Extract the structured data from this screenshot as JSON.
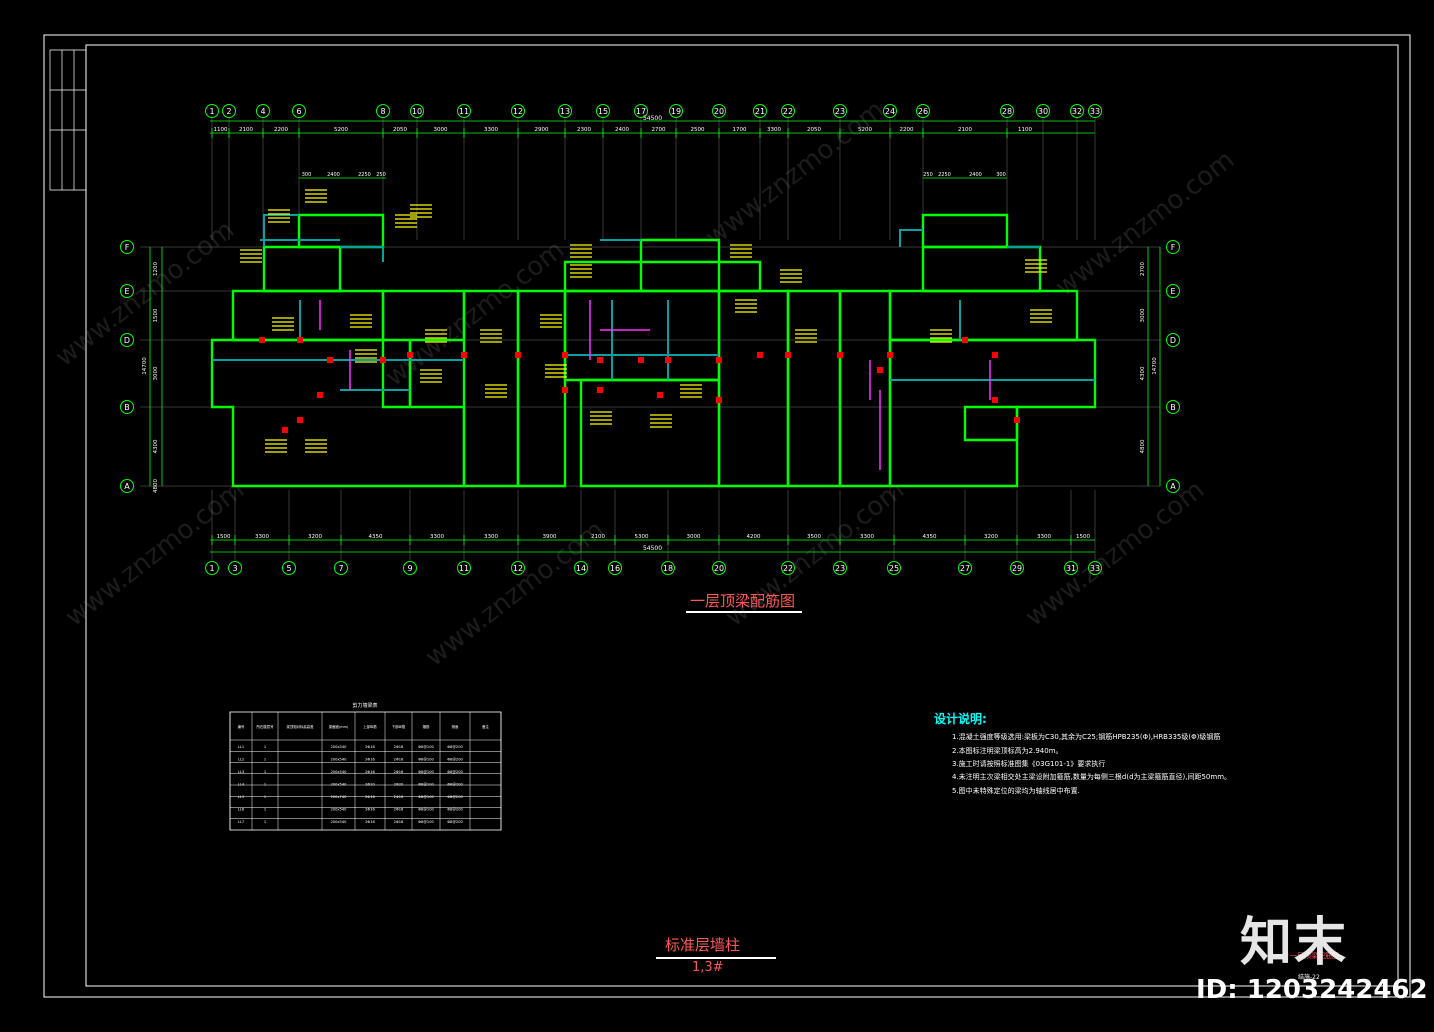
{
  "drawing": {
    "plan_title": "一层顶梁配筋图",
    "sub_title": "标准层墙柱",
    "sub_title_2": "1,3#",
    "total_dim": "54500",
    "top_axes": [
      "1",
      "2",
      "4",
      "6",
      "8",
      "10",
      "11",
      "12",
      "13",
      "15",
      "17",
      "19",
      "20",
      "21",
      "22",
      "23",
      "24",
      "26",
      "28",
      "30",
      "32",
      "33"
    ],
    "top_dims": [
      "1100",
      "2100",
      "2200",
      "5200",
      "2050",
      "3000",
      "3300",
      "2900",
      "2300",
      "2400",
      "2700",
      "2500",
      "1700",
      "3300",
      "2050",
      "5200",
      "2200",
      "2100",
      "1100"
    ],
    "bottom_axes": [
      "1",
      "3",
      "5",
      "7",
      "9",
      "11",
      "12",
      "14",
      "16",
      "18",
      "20",
      "22",
      "23",
      "25",
      "27",
      "29",
      "31",
      "33"
    ],
    "bottom_dims": [
      "1500",
      "3300",
      "3200",
      "4350",
      "3300",
      "3300",
      "3900",
      "2100",
      "5300",
      "3000",
      "4200",
      "3500",
      "3300",
      "4350",
      "3200",
      "3300",
      "1500"
    ],
    "row_axes": [
      "F",
      "E",
      "D",
      "B",
      "A"
    ],
    "left_dims": [
      "1200",
      "1500",
      "3000",
      "4300",
      "4800"
    ],
    "left_total": "14700",
    "right_dims": [
      "2700",
      "3000",
      "4300",
      "4800"
    ],
    "right_total": "14700",
    "upper_sub_dims_left": [
      "300",
      "2400",
      "2250",
      "250"
    ],
    "upper_sub_dims_right": [
      "250",
      "2250",
      "2400",
      "300"
    ]
  },
  "table": {
    "title": "剪力墙梁表",
    "headers": [
      "编号",
      "所在楼层号",
      "梁顶相对标高高差",
      "梁截面(mm)",
      "上部纵筋",
      "下部纵筋",
      "箍筋",
      "侧面",
      "备注"
    ],
    "rows": [
      [
        "LL1",
        "1",
        "",
        "200x540",
        "2Φ16",
        "2Φ16",
        "Φ8@100",
        "Φ8@200",
        ""
      ],
      [
        "LL2",
        "1",
        "",
        "200x540",
        "2Φ16",
        "2Φ16",
        "Φ8@100",
        "Φ8@200",
        ""
      ],
      [
        "LL3",
        "1",
        "",
        "200x540",
        "2Φ16",
        "2Φ16",
        "Φ8@100",
        "Φ8@200",
        ""
      ],
      [
        "LL4",
        "1",
        "",
        "200x540",
        "2Φ20",
        "2Φ20",
        "Φ8@100",
        "Φ8@200",
        ""
      ],
      [
        "LL5",
        "1",
        "",
        "200x740",
        "2Φ16",
        "2Φ16",
        "Φ8@100",
        "Φ8@200",
        ""
      ],
      [
        "LL6",
        "1",
        "",
        "200x540",
        "2Φ16",
        "2Φ16",
        "Φ8@100",
        "Φ8@200",
        ""
      ],
      [
        "LL7",
        "1",
        "",
        "200x540",
        "2Φ18",
        "2Φ18",
        "Φ8@100",
        "Φ8@200",
        ""
      ]
    ]
  },
  "notes": {
    "heading": "设计说明:",
    "items": [
      "1.混凝土强度等级选用:梁板为C30,其余为C25;钢筋HPB235(Φ),HRB335级(Φ)级钢筋",
      "2.本图标注明梁顶标高为2.940m。",
      "3.施工时请按照标准图集《03G101-1》要求执行",
      "4.未注明主次梁相交处主梁设附加箍筋,数量为每侧三根d(d为主梁箍筋直径),间距50mm。",
      "5.图中未特殊定位的梁均为轴线居中布置."
    ]
  },
  "title_block": {
    "stamp_title": "一层顶梁配筋图",
    "drawing_no": "结施-22"
  },
  "watermark": {
    "brand": "知末",
    "site": "www.znzmo.com",
    "image_id": "ID: 1203242462"
  },
  "colors": {
    "wall": "#00ff00",
    "beam": "#0aa0a0",
    "dim": "#00ff00",
    "label": "#ffff00",
    "column": "#ff0000",
    "grid": "#ffffff"
  }
}
